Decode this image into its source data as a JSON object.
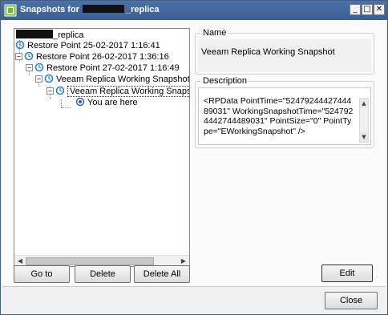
{
  "window": {
    "title_prefix": "Snapshots for",
    "title_suffix": "_replica",
    "controls": {
      "minimize": "_",
      "maximize": "□",
      "close": "✕"
    }
  },
  "tree": {
    "root_suffix": "_replica",
    "nodes": [
      {
        "label": "Restore Point 25-02-2017 1:16:41"
      },
      {
        "label": "Restore Point 26-02-2017 1:36:16",
        "expander": "−"
      },
      {
        "label": "Restore Point 27-02-2017 1:16:49",
        "expander": "−"
      },
      {
        "label": "Veeam Replica Working Snapshot",
        "expander": "−"
      },
      {
        "label": "Veeam Replica Working Snapsh",
        "expander": "−"
      },
      {
        "label": "You are here"
      }
    ],
    "scroll_left": "◀",
    "scroll_right": "▶"
  },
  "buttons": {
    "goto": "Go to",
    "delete": "Delete",
    "delete_all": "Delete All",
    "edit": "Edit",
    "close": "Close"
  },
  "name_group": {
    "legend": "Name",
    "value": "Veeam Replica Working Snapshot"
  },
  "description_group": {
    "legend": "Description",
    "value": "<RPData PointTime=\"5247924442744489031\" WorkingSnapshotTime=\"5247924442744489031\" PointSize=\"0\" PointType=\"EWorkingSnapshot\" />",
    "scroll_up": "▲",
    "scroll_down": "▼"
  },
  "colors": {
    "titlebar": "#3a5f94",
    "restore_icon": "#2a7fd6"
  }
}
